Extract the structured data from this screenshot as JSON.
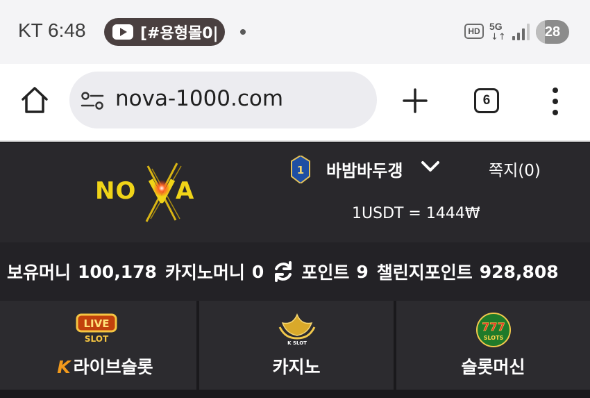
{
  "status_bar": {
    "carrier_time": "KT 6:48",
    "notification_text": "[#용형몰0|",
    "hd_label": "HD",
    "network_label": "5G",
    "network_arrows": "↓↑",
    "battery_level": "28"
  },
  "browser": {
    "url": "nova-1000.com",
    "tab_count": "6"
  },
  "site": {
    "brand_logo_text": "NOVA",
    "grade_level": "1",
    "username": "바밤바두갱",
    "messages_label": "쪽지(0)",
    "exchange_rate": "1USDT = 1444₩"
  },
  "balance": {
    "money_label": "보유머니",
    "money_value": "100,178",
    "casino_label": "카지노머니",
    "casino_value": "0",
    "point_label": "포인트",
    "point_value": "9",
    "challenge_label": "챌린지포인트",
    "challenge_value": "928,808"
  },
  "nav": {
    "items": [
      {
        "label": "라이브슬롯",
        "badge_top": "LIVE",
        "badge_bottom": "SLOT",
        "prefix": "K"
      },
      {
        "label": "카지노",
        "badge": "K SLOT"
      },
      {
        "label": "슬롯머신",
        "badge": "777 SLOTS"
      }
    ]
  },
  "colors": {
    "header_bg": "#29282c",
    "logo_yellow": "#f0d418",
    "accent_orange": "#f29a1c"
  }
}
